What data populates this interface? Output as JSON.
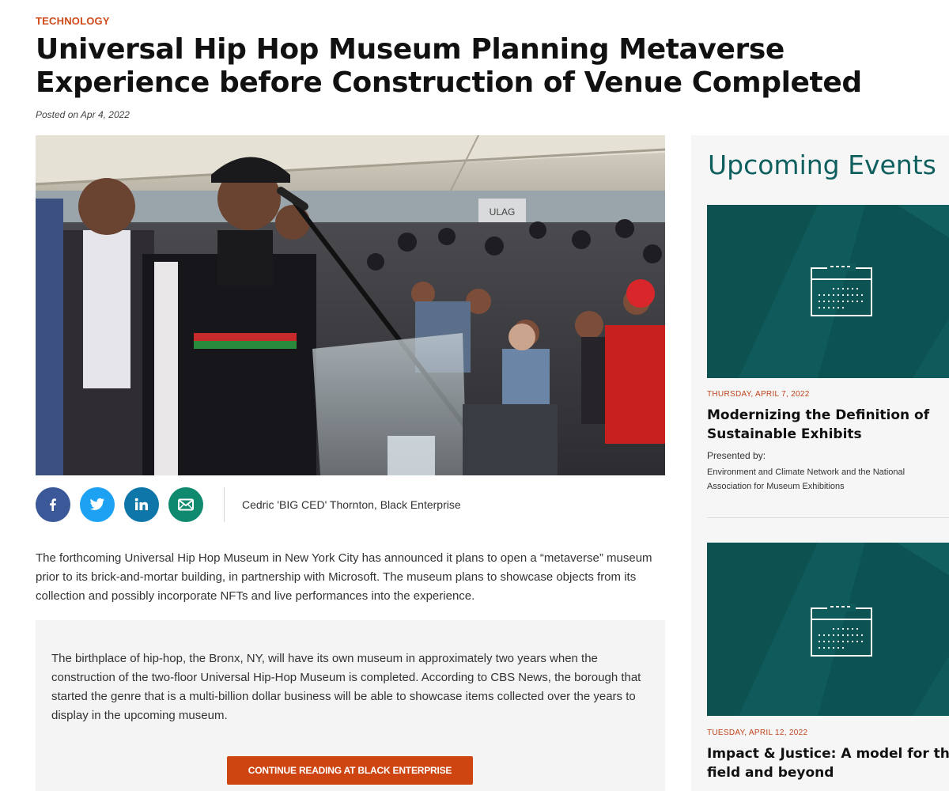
{
  "article": {
    "category": "TECHNOLOGY",
    "title": "Universal Hip Hop Museum Planning Metaverse Experience before Construction of Venue Completed",
    "posted": "Posted on Apr 4, 2022",
    "photo_credit": "Cedric 'BIG CED' Thornton, Black Enterprise",
    "lede": "The forthcoming Universal Hip Hop Museum in New York City has announced it plans to open a “metaverse” museum prior to its brick-and-mortar building, in partnership with Microsoft. The museum plans to showcase objects from its collection and possibly incorporate NFTs and live performances into the experience.",
    "excerpt": "The birthplace of hip-hop, the Bronx, NY, will have its own museum in approximately two years when the construction of the two-floor Universal Hip-Hop Museum is completed. According to CBS News, the borough that started the genre that is a multi-billion dollar business will be able to showcase items collected over the years to display in the upcoming museum.",
    "cta_label": "CONTINUE READING AT BLACK ENTERPRISE",
    "photo_sign": "ULAG"
  },
  "share": {
    "icons": [
      "facebook-icon",
      "twitter-icon",
      "linkedin-icon",
      "email-icon"
    ],
    "colors": {
      "facebook": "#3b5998",
      "twitter": "#1da1f2",
      "linkedin": "#0e76a8",
      "email": "#0f8a6e"
    }
  },
  "sidebar": {
    "title": "Upcoming Events",
    "events": [
      {
        "date": "THURSDAY, APRIL 7, 2022",
        "title_line1": "Modernizing the Definition of",
        "title_line2": "Sustainable Exhibits",
        "presented_label": "Presented by:",
        "presented_by_line1": "Environment and Climate Network and the National",
        "presented_by_line2": "Association for Museum Exhibitions",
        "icon": "calendar-icon"
      },
      {
        "date": "TUESDAY, APRIL 12, 2022",
        "title_line1": "Impact & Justice: A model for the",
        "title_line2": "field and beyond",
        "icon": "calendar-icon"
      }
    ]
  },
  "colors": {
    "accent": "#cf4a1a",
    "events_teal": "#0f5a5a",
    "heading_teal": "#0f5f5f"
  }
}
